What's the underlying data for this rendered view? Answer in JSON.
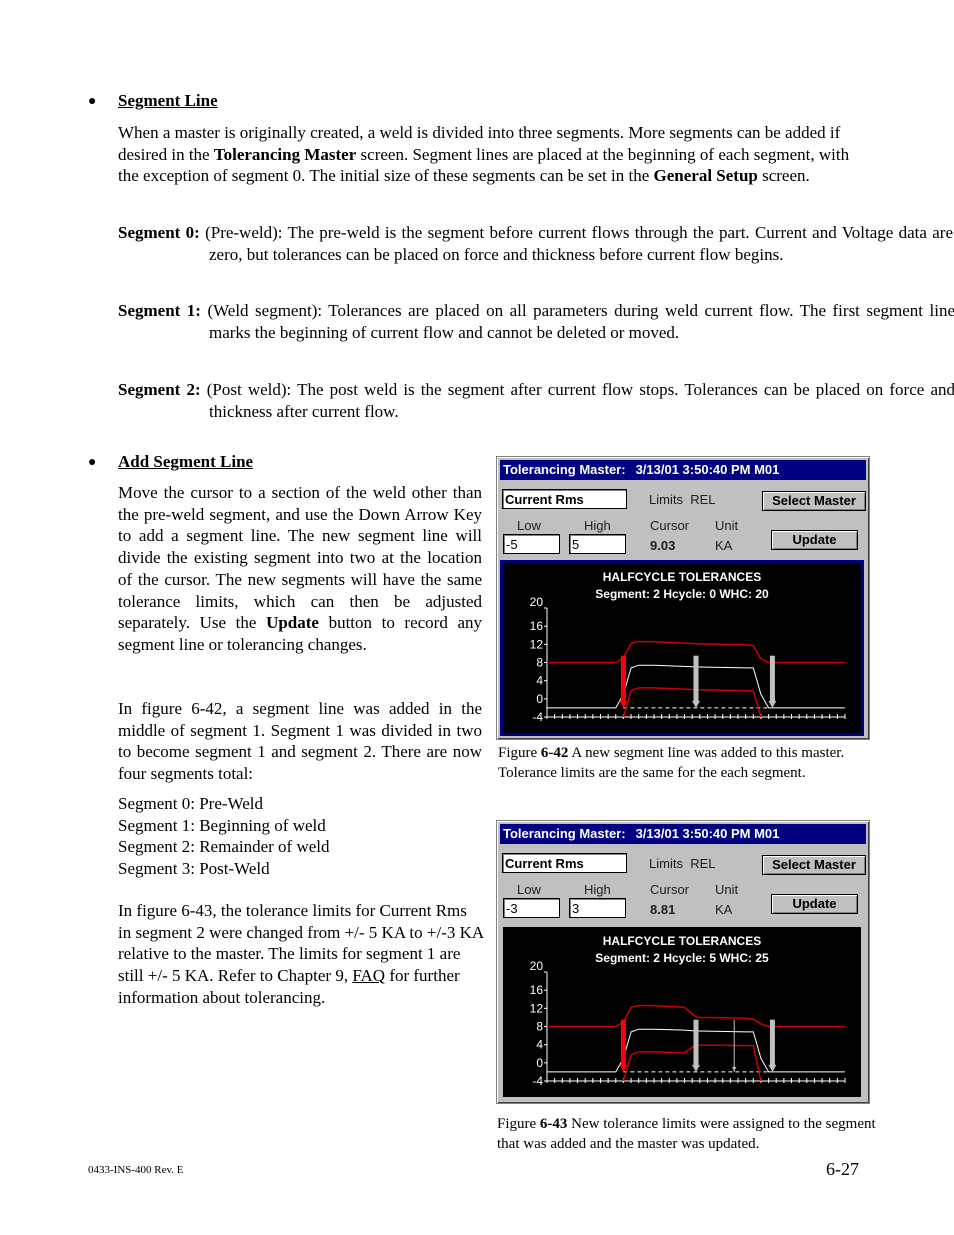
{
  "section1": {
    "heading": "Segment Line",
    "intro_parts": [
      {
        "t": "When a master is originally created, a weld is divided into three segments. More segments can be added if desired in the ",
        "b": false
      },
      {
        "t": "Tolerancing Master",
        "b": true
      },
      {
        "t": " screen.  Segment lines are placed at the beginning of each segment, with the exception of segment 0. The initial size of these segments can be set in the ",
        "b": false
      },
      {
        "t": "General Setup",
        "b": true
      },
      {
        "t": " screen.",
        "b": false
      }
    ],
    "segments": [
      {
        "label": "Segment 0:",
        "text": " (Pre-weld): The pre-weld is the segment before current flows through the part. Current and Voltage data are zero, but tolerances can be placed on force and thickness before current flow begins."
      },
      {
        "label": "Segment 1:",
        "text": " (Weld segment): Tolerances are placed on all parameters during weld current flow. The first segment line marks the beginning of current flow and cannot be deleted or moved."
      },
      {
        "label": "Segment 2:",
        "text": " (Post weld): The post weld is the segment after current flow stops. Tolerances can be placed on force and thickness after current flow."
      }
    ]
  },
  "section2": {
    "heading": "Add Segment Line",
    "p1_parts": [
      {
        "t": "Move the cursor to a section of the weld other than the pre-weld segment, and use the Down Arrow Key to add a segment line. The new segment line will divide the existing segment into two at the location of the cursor. The new segments will have the same tolerance limits, which can then be adjusted separately. Use the ",
        "b": false
      },
      {
        "t": "Update",
        "b": true
      },
      {
        "t": " button to record any segment line or tolerancing changes.",
        "b": false
      }
    ],
    "p2": "In figure 6-42, a segment line was added in the middle of segment 1. Segment 1 was divided in two to become segment 1 and segment 2. There are now four segments total:",
    "list": [
      "Segment 0:  Pre-Weld",
      "Segment 1: Beginning of weld",
      "Segment 2: Remainder of weld",
      "Segment 3: Post-Weld"
    ],
    "p3": "In figure 6-43, the tolerance limits for Current Rms in segment  2 were changed from +/- 5 KA to +/-3 KA relative to the master. The limits for segment 1 are still +/- 5 KA. Refer to Chapter 9, ",
    "p3_link": "FAQ",
    "p3_end": " for further information about tolerancing."
  },
  "figures": [
    {
      "window": {
        "title": "Tolerancing Master:",
        "timestamp": "3/13/01 3:50:40 PM M01",
        "parameter": "Current Rms",
        "limits_label": "Limits",
        "limits_value": "REL",
        "select_master": "Select Master",
        "low_label": "Low",
        "high_label": "High",
        "low_value": "-5",
        "high_value": "5",
        "cursor_label": "Cursor",
        "cursor_value": "9.03",
        "unit_label": "Unit",
        "unit_value": "KA",
        "update": "Update"
      },
      "caption_label": "Figure ",
      "caption_num": "6-42",
      "caption_text": " A new segment line was added to this master. Tolerance limits are the same for the each segment."
    },
    {
      "window": {
        "title": "Tolerancing Master:",
        "timestamp": "3/13/01 3:50:40 PM M01",
        "parameter": "Current Rms",
        "limits_label": "Limits",
        "limits_value": "REL",
        "select_master": "Select Master",
        "low_label": "Low",
        "high_label": "High",
        "low_value": "-3",
        "high_value": "3",
        "cursor_label": "Cursor",
        "cursor_value": "8.81",
        "unit_label": "Unit",
        "unit_value": "KA",
        "update": "Update"
      },
      "caption_label": "Figure ",
      "caption_num": "6-43",
      "caption_text": " New tolerance limits were assigned to the segment that was added and the master was updated."
    }
  ],
  "chart_data": [
    {
      "type": "line",
      "title": "HALFCYCLE TOLERANCES",
      "subtitle": "Segment: 2    Hcycle: 0    WHC: 20",
      "ylim": [
        -4,
        20
      ],
      "yticks": [
        20,
        16,
        12,
        8,
        4,
        0,
        -4
      ],
      "xlim": [
        0,
        39
      ],
      "colors": {
        "master": "#ffffff",
        "limit": "#cc0000",
        "segment_marker": "#c0c0c0",
        "first_marker": "#ff0000"
      },
      "x": [
        0,
        9,
        10,
        11,
        12,
        14,
        20,
        26,
        27,
        28,
        29,
        39
      ],
      "series": [
        {
          "name": "master",
          "values": [
            -2,
            -2,
            1,
            6.8,
            7.4,
            7.4,
            7.0,
            6.8,
            6.8,
            1,
            -2,
            -2
          ]
        },
        {
          "name": "upper-limit",
          "values": [
            8,
            8,
            9,
            12.2,
            12.6,
            12.6,
            12.1,
            11.9,
            11.7,
            8.8,
            8,
            8
          ]
        },
        {
          "name": "lower-limit",
          "values": [
            null,
            null,
            -4,
            1.8,
            2.4,
            2.4,
            2.0,
            1.8,
            1.8,
            -4,
            null,
            null
          ]
        }
      ],
      "segment_lines": [
        {
          "x": 10,
          "style": "first"
        },
        {
          "x": 19.5,
          "style": "thick"
        },
        {
          "x": 29.5,
          "style": "thick"
        }
      ],
      "dashed_baseline": {
        "y": -2,
        "from": 10,
        "to": 29
      }
    },
    {
      "type": "line",
      "title": "HALFCYCLE TOLERANCES",
      "subtitle": "Segment: 2    Hcycle: 5    WHC: 25",
      "ylim": [
        -4,
        20
      ],
      "yticks": [
        20,
        16,
        12,
        8,
        4,
        0,
        -4
      ],
      "xlim": [
        0,
        39
      ],
      "colors": {
        "master": "#ffffff",
        "limit": "#cc0000",
        "segment_marker": "#c0c0c0",
        "first_marker": "#ff0000"
      },
      "x": [
        0,
        9,
        10,
        11,
        12,
        14,
        18,
        19.5,
        20,
        26,
        27,
        28,
        29,
        39
      ],
      "series": [
        {
          "name": "master",
          "values": [
            -2,
            -2,
            1,
            6.8,
            7.4,
            7.4,
            7.2,
            7.0,
            7.0,
            6.8,
            6.8,
            1,
            -2,
            -2
          ]
        },
        {
          "name": "upper-limit",
          "values": [
            8,
            8,
            9,
            12.2,
            12.6,
            12.6,
            12.2,
            10.1,
            10.0,
            9.8,
            9.6,
            8.6,
            8,
            8
          ]
        },
        {
          "name": "lower-limit",
          "values": [
            null,
            null,
            -4,
            1.8,
            2.4,
            2.4,
            2.2,
            4.0,
            3.9,
            3.8,
            3.8,
            -4,
            null,
            null
          ]
        }
      ],
      "segment_lines": [
        {
          "x": 10,
          "style": "first"
        },
        {
          "x": 19.5,
          "style": "thick"
        },
        {
          "x": 24.5,
          "style": "cursor"
        },
        {
          "x": 29.5,
          "style": "thick"
        }
      ],
      "dashed_baseline": {
        "y": -2,
        "from": 10,
        "to": 29
      }
    }
  ],
  "footer": {
    "doc_id": "0433-INS-400 Rev. E",
    "page": "6-27"
  }
}
